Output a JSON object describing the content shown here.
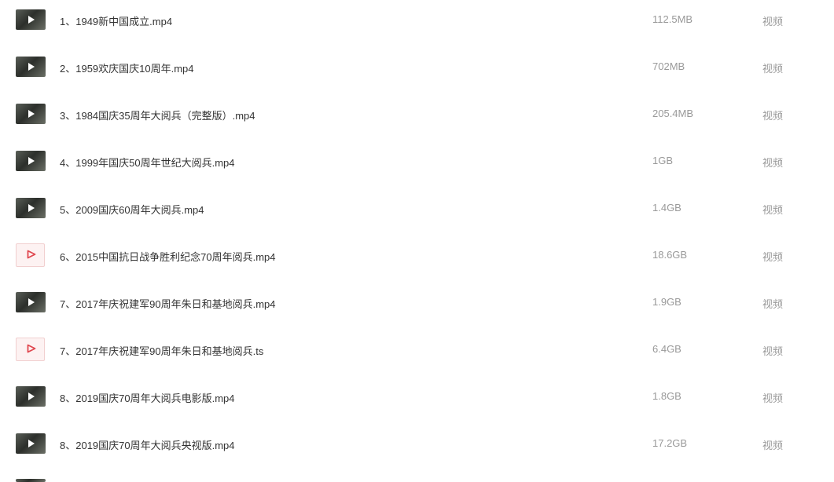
{
  "files": [
    {
      "name": "1、1949新中国成立.mp4",
      "size": "112.5MB",
      "type": "视频",
      "thumb": "video-thumbnail"
    },
    {
      "name": "2、1959欢庆国庆10周年.mp4",
      "size": "702MB",
      "type": "视频",
      "thumb": "video-thumbnail"
    },
    {
      "name": "3、1984国庆35周年大阅兵（完整版）.mp4",
      "size": "205.4MB",
      "type": "视频",
      "thumb": "video-thumbnail"
    },
    {
      "name": "4、1999年国庆50周年世纪大阅兵.mp4",
      "size": "1GB",
      "type": "视频",
      "thumb": "video-thumbnail"
    },
    {
      "name": "5、2009国庆60周年大阅兵.mp4",
      "size": "1.4GB",
      "type": "视频",
      "thumb": "video-thumbnail"
    },
    {
      "name": "6、2015中国抗日战争胜利纪念70周年阅兵.mp4",
      "size": "18.6GB",
      "type": "视频",
      "thumb": "video-file-icon"
    },
    {
      "name": "7、2017年庆祝建军90周年朱日和基地阅兵.mp4",
      "size": "1.9GB",
      "type": "视频",
      "thumb": "video-thumbnail"
    },
    {
      "name": "7、2017年庆祝建军90周年朱日和基地阅兵.ts",
      "size": "6.4GB",
      "type": "视频",
      "thumb": "video-file-icon"
    },
    {
      "name": "8、2019国庆70周年大阅兵电影版.mp4",
      "size": "1.8GB",
      "type": "视频",
      "thumb": "video-thumbnail"
    },
    {
      "name": "8、2019国庆70周年大阅兵央视版.mp4",
      "size": "17.2GB",
      "type": "视频",
      "thumb": "video-thumbnail"
    }
  ],
  "colors": {
    "text": "#333333",
    "muted": "#999999",
    "accent": "#e0474f"
  }
}
